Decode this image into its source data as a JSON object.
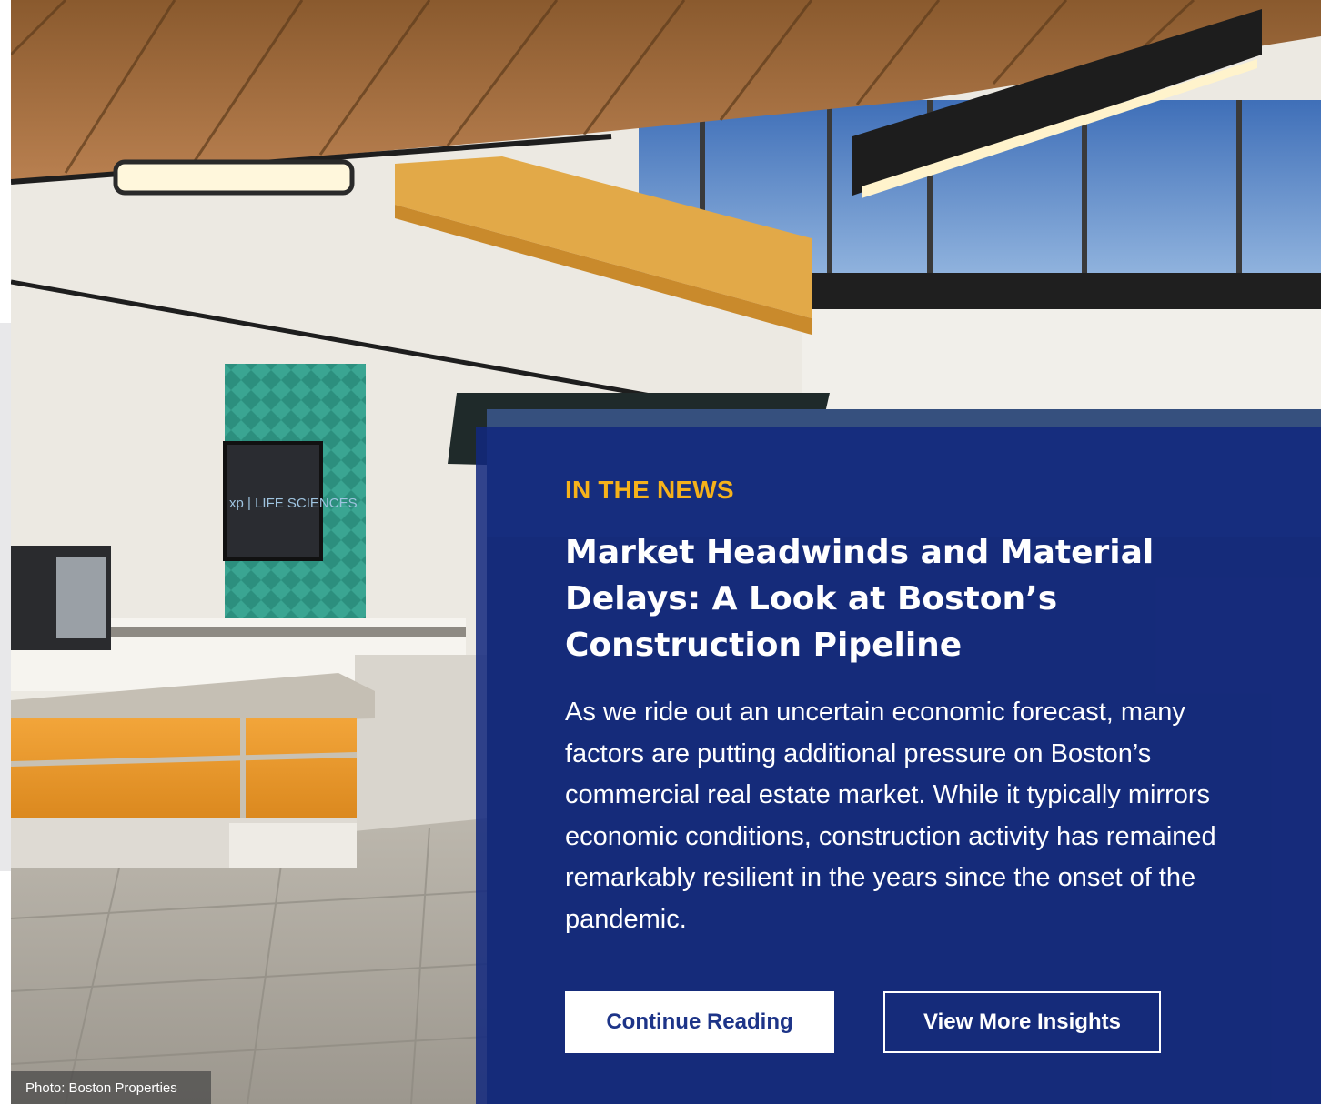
{
  "hero": {
    "screen_text": "xp | LIFE SCIENCES",
    "credit": "Photo: Boston Properties"
  },
  "card": {
    "eyebrow": "IN THE NEWS",
    "headline": "Market Headwinds and Material Delays: A Look at Boston’s Construction Pipeline",
    "body": "As we ride out an uncertain economic forecast, many factors are putting additional pressure on Boston’s commercial real estate market. While it typically mirrors economic conditions, construction activity has remained remarkably resilient in the years since the onset of the pandemic.",
    "primary_button": "Continue Reading",
    "secondary_button": "View More Insights"
  },
  "colors": {
    "card_blue": "#12287e",
    "eyebrow_gold": "#f6b21a",
    "button_text_blue": "#1d3488"
  }
}
